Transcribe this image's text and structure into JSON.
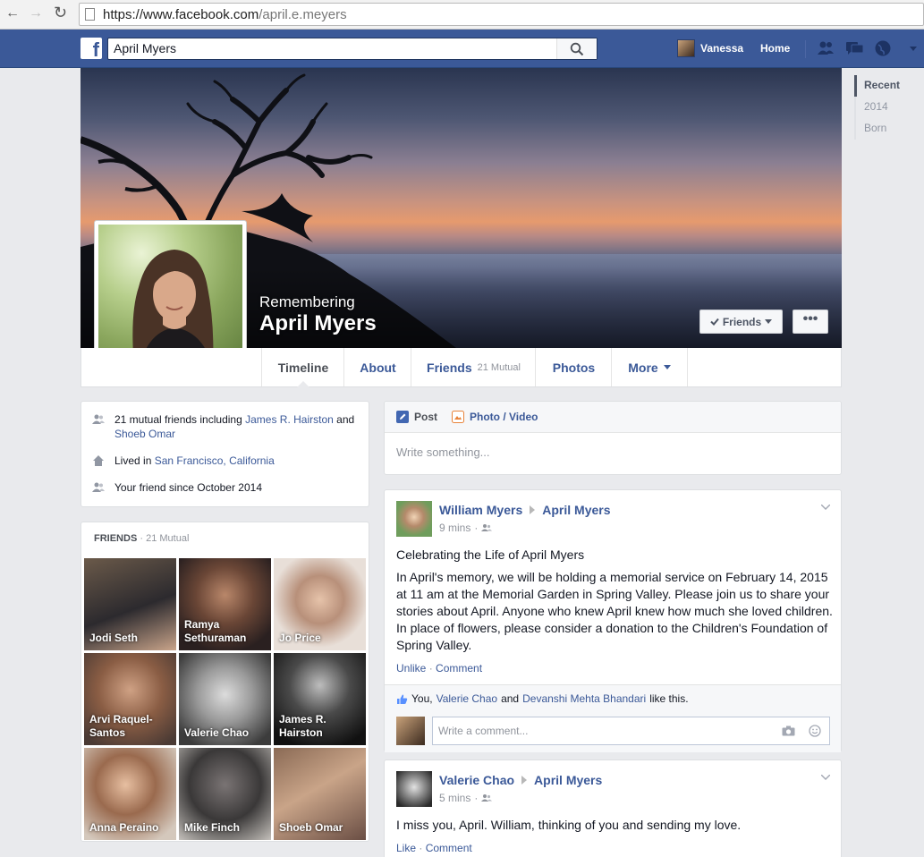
{
  "browser": {
    "url_host": "https://www.facebook.com",
    "url_path": "/april.e.meyers"
  },
  "bluebar": {
    "logo": "f",
    "search_value": "April Myers",
    "user_name": "Vanessa",
    "home_label": "Home"
  },
  "profile": {
    "remembering_label": "Remembering",
    "name": "April Myers",
    "friends_button_label": "Friends",
    "more_button_label": "•••"
  },
  "tabs": [
    {
      "label": "Timeline",
      "sub": ""
    },
    {
      "label": "About",
      "sub": ""
    },
    {
      "label": "Friends",
      "sub": "21 Mutual"
    },
    {
      "label": "Photos",
      "sub": ""
    },
    {
      "label": "More",
      "sub": ""
    }
  ],
  "scrubber": [
    "Recent",
    "2014",
    "Born"
  ],
  "intro": {
    "mutual_prefix": "21 mutual friends including",
    "mutual_friend_1": "James R. Hairston",
    "mutual_and": "and",
    "mutual_friend_2": "Shoeb Omar",
    "lived_prefix": "Lived in",
    "lived_place": "San Francisco, California",
    "friend_since": "Your friend since October 2014"
  },
  "friends_box": {
    "title": "FRIENDS",
    "separator": "·",
    "count": "21 Mutual",
    "friends": [
      {
        "name": "Jodi Seth"
      },
      {
        "name": "Ramya Sethuraman"
      },
      {
        "name": "Jo Price"
      },
      {
        "name": "Arvi Raquel-Santos"
      },
      {
        "name": "Valerie Chao"
      },
      {
        "name": "James R. Hairston"
      },
      {
        "name": "Anna Peraino"
      },
      {
        "name": "Mike Finch"
      },
      {
        "name": "Shoeb Omar"
      }
    ]
  },
  "composer": {
    "post_label": "Post",
    "photo_label": "Photo / Video",
    "placeholder": "Write something..."
  },
  "posts": [
    {
      "author": "William Myers",
      "target": "April Myers",
      "time": "9 mins",
      "separator": "·",
      "title": "Celebrating the Life of April Myers",
      "body": "In April's memory, we will be holding a memorial service on February 14, 2015 at 11 am at the Memorial Garden in Spring Valley. Please join us to share your stories about April. Anyone who knew April knew how much she loved children. In place of flowers, please consider a donation to the Children's Foundation of Spring Valley.",
      "action_like": "Unlike",
      "action_comment": "Comment",
      "likes_you": "You,",
      "likes_person_1": "Valerie Chao",
      "likes_and": "and",
      "likes_person_2": "Devanshi Mehta Bhandari",
      "likes_suffix": "like this.",
      "comment_placeholder": "Write a comment..."
    },
    {
      "author": "Valerie Chao",
      "target": "April Myers",
      "time": "5 mins",
      "separator": "·",
      "body": "I miss you, April. William, thinking of you and sending my love.",
      "action_like": "Like",
      "action_comment": "Comment"
    }
  ],
  "colors": {
    "fb_blue": "#3b5998",
    "page_bg": "#e9eaed",
    "muted": "#90949c"
  }
}
